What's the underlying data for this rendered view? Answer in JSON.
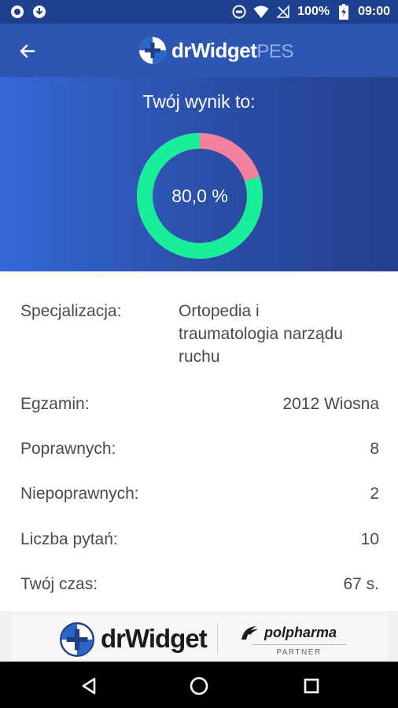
{
  "status_bar": {
    "battery_percent": "100%",
    "time": "09:00",
    "icons": [
      "record-icon",
      "download-icon",
      "circle-dots-icon",
      "wifi-icon",
      "no-signal-icon",
      "battery-charging-icon"
    ]
  },
  "app_bar": {
    "back_icon": "arrow-left-icon",
    "brand_name": "drWidget",
    "brand_suffix": "PES"
  },
  "result": {
    "heading": "Twój wynik to:",
    "score_label": "80,0 %",
    "score_fraction": 0.8,
    "correct_color": "#19ef9a",
    "incorrect_color": "#f2829f"
  },
  "details": {
    "specialization": {
      "label": "Specjalizacja:",
      "value_lines": [
        "Ortopedia i",
        "traumatologia narządu",
        "ruchu"
      ]
    },
    "exam": {
      "label": "Egzamin:",
      "value": "2012 Wiosna"
    },
    "correct": {
      "label": "Poprawnych:",
      "value": "8"
    },
    "incorrect": {
      "label": "Niepoprawnych:",
      "value": "2"
    },
    "questions": {
      "label": "Liczba pytań:",
      "value": "10"
    },
    "time": {
      "label": "Twój czas:",
      "value": "67 s."
    }
  },
  "footer": {
    "brand": "drWidget",
    "partner_name": "polpharma",
    "partner_tag": "PARTNER"
  },
  "nav_bar": {
    "back_icon": "triangle-back-icon",
    "home_icon": "circle-home-icon",
    "recents_icon": "square-recents-icon"
  },
  "colors": {
    "status_bar": "#1f3f8f",
    "app_bar": "#2d56b3",
    "hero_start": "#3467d6",
    "hero_end": "#243f8f"
  }
}
